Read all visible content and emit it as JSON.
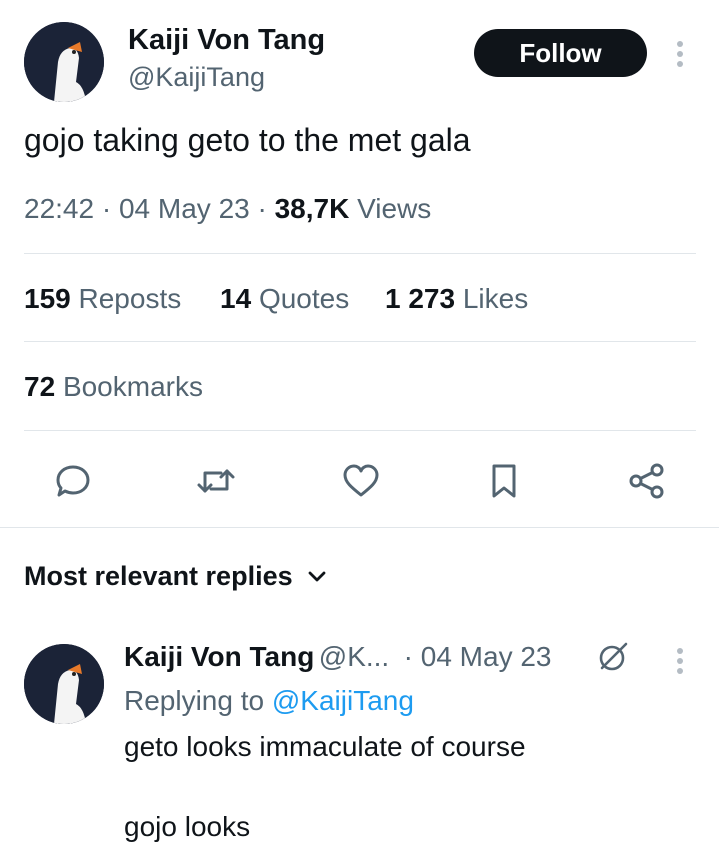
{
  "tweet": {
    "author_name": "Kaiji Von Tang",
    "author_handle": "@KaijiTang",
    "follow_label": "Follow",
    "text": "gojo taking geto to the met gala",
    "time": "22:42",
    "dot": "·",
    "date": "04 May 23",
    "views_count": "38,7K",
    "views_label": "Views"
  },
  "stats": {
    "reposts_count": "159",
    "reposts_label": "Reposts",
    "quotes_count": "14",
    "quotes_label": "Quotes",
    "likes_count": "1 273",
    "likes_label": "Likes",
    "bookmarks_count": "72",
    "bookmarks_label": "Bookmarks"
  },
  "actions": [
    "reply-icon",
    "repost-icon",
    "like-icon",
    "bookmark-icon",
    "share-icon"
  ],
  "replies_header": "Most relevant replies",
  "reply": {
    "author_name": "Kaiji Von Tang",
    "author_handle": "@K...",
    "date": "· 04 May 23",
    "replying_to_prefix": "Replying to",
    "replying_to_handle": "@KaijiTang",
    "line1": "geto looks immaculate of course",
    "line2": "gojo looks"
  },
  "colors": {
    "text": "#0f1419",
    "secondary": "#536471",
    "link": "#1d9bf0",
    "avatar_bg": "#1b2337"
  }
}
